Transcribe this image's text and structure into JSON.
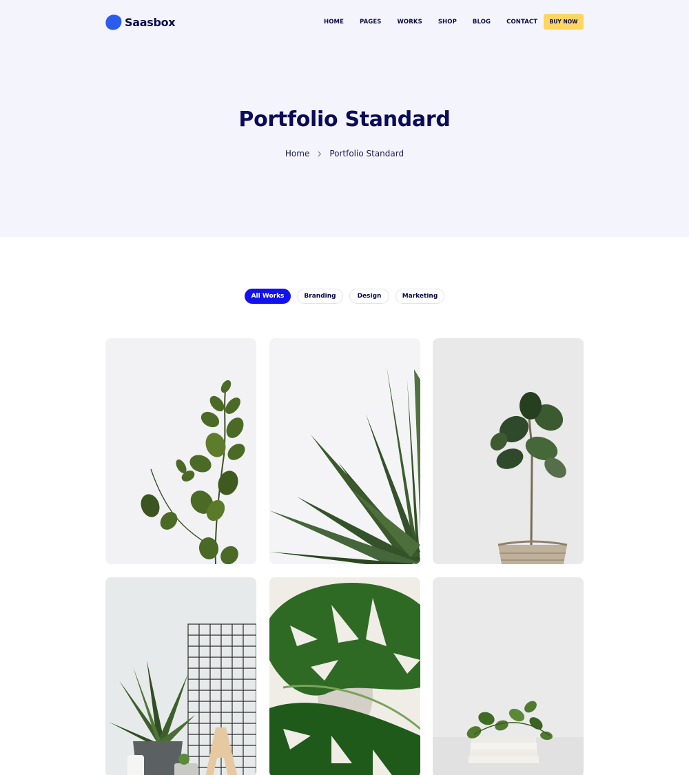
{
  "brand": {
    "name": "Saasbox",
    "accent": "#2b5cf0"
  },
  "nav": {
    "items": [
      "HOME",
      "PAGES",
      "WORKS",
      "SHOP",
      "BLOG",
      "CONTACT"
    ],
    "cta_label": "BUY NOW",
    "cta_color": "#fcd660"
  },
  "hero": {
    "title": "Portfolio Standard",
    "breadcrumb": {
      "home": "Home",
      "current": "Portfolio Standard",
      "separator_icon": "chevron-right-icon"
    }
  },
  "filters": {
    "items": [
      "All Works",
      "Branding",
      "Design",
      "Marketing"
    ],
    "active": "All Works",
    "active_color": "#1212f0"
  },
  "portfolio": {
    "items": [
      {
        "image": "eucalyptus-branch"
      },
      {
        "image": "spiky-plant-leaves"
      },
      {
        "image": "fiddle-leaf-fig-in-basket"
      },
      {
        "image": "potted-palm-with-wire-grid"
      },
      {
        "image": "monstera-leaves"
      },
      {
        "image": "plant-sprig-on-books"
      }
    ]
  }
}
